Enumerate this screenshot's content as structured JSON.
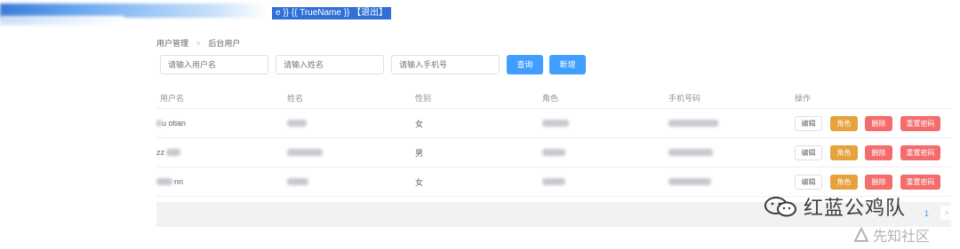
{
  "header": {
    "user_label": "e }} {{ TrueName }} 【退出】"
  },
  "breadcrumb": {
    "parent": "用户管理",
    "separator": ">",
    "current": "后台用户"
  },
  "filters": {
    "username_placeholder": "请输入用户名",
    "name_placeholder": "请输入姓名",
    "phone_placeholder": "请输入手机号",
    "search_label": "查询",
    "add_label": "新增"
  },
  "table": {
    "headers": [
      "用户名",
      "姓名",
      "性别",
      "角色",
      "手机号码",
      "操作"
    ],
    "rows": [
      {
        "username": "u otian",
        "name": "",
        "gender": "女",
        "role": "",
        "phone": "1 5 2"
      },
      {
        "username": "zz",
        "name": "",
        "gender": "男",
        "role": "",
        "phone": "0 0"
      },
      {
        "username": "nn",
        "name": "",
        "gender": "女",
        "role": "",
        "phone": "0 0"
      }
    ],
    "actions": {
      "edit": "编辑",
      "role": "角色",
      "delete": "删除",
      "reset_password": "重置密码"
    }
  },
  "pagination": {
    "current_page": "1",
    "next": ">"
  },
  "watermarks": {
    "primary": "红蓝公鸡队",
    "secondary": "先知社区"
  },
  "colors": {
    "primary": "#409eff",
    "warning": "#e6a23c",
    "danger": "#f56c6c",
    "header_highlight": "#2f6fd6"
  }
}
